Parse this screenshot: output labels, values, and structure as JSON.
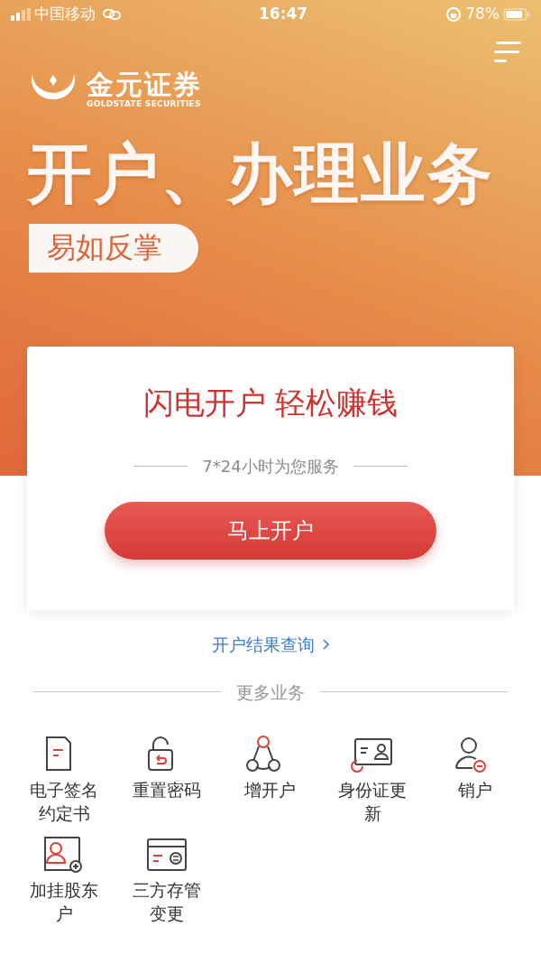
{
  "status_bar": {
    "carrier": "中国移动",
    "time": "16:47",
    "battery": "78%"
  },
  "hero": {
    "brand": "金元证券",
    "brand_en": "GOLDSTATE SECURITIES",
    "headline": "开户、办理业务",
    "tagline": "易如反掌"
  },
  "card": {
    "title": "闪电开户 轻松赚钱",
    "subtitle": "7*24小时为您服务",
    "button": "马上开户"
  },
  "result_link": "开户结果查询",
  "section_title": "更多业务",
  "services": [
    {
      "label": "电子签名约定书"
    },
    {
      "label": "重置密码"
    },
    {
      "label": "增开户"
    },
    {
      "label": "身份证更新"
    },
    {
      "label": "销户"
    },
    {
      "label": "加挂股东户"
    },
    {
      "label": "三方存管变更"
    }
  ]
}
